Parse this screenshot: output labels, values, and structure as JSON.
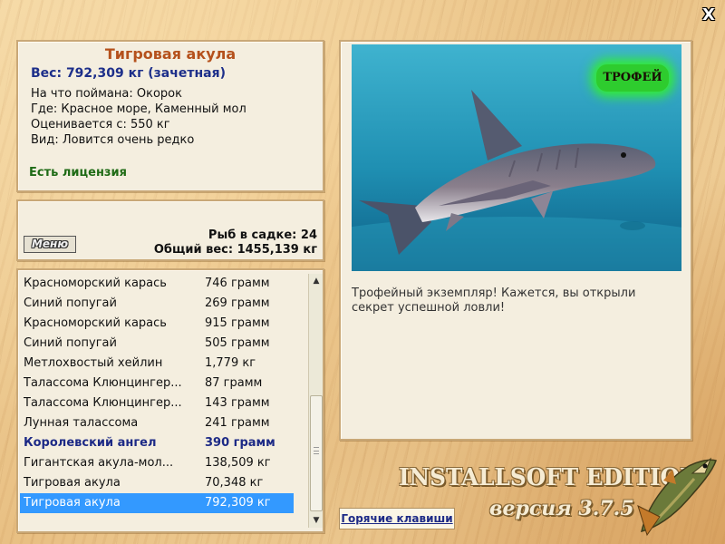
{
  "window": {
    "close_label": "X"
  },
  "fish": {
    "name": "Тигровая акула",
    "weight": "Вес: 792,309 кг (зачетная)",
    "bait": "На что поймана: Окорок",
    "location": "Где: Красное море, Каменный мол",
    "valued_from": "Оценивается с: 550 кг",
    "species": "Вид: Ловится очень редко",
    "license": "Есть лицензия"
  },
  "stats": {
    "menu_label": "Меню",
    "fish_in_keepnet": "Рыб в садке: 24",
    "total_weight": "Общий вес: 1455,139 кг"
  },
  "catch_list": [
    {
      "name": "Красноморский карась",
      "weight": "746 грамм",
      "style": "normal"
    },
    {
      "name": "Синий попугай",
      "weight": "269 грамм",
      "style": "normal"
    },
    {
      "name": "Красноморский карась",
      "weight": "915 грамм",
      "style": "normal"
    },
    {
      "name": "Синий попугай",
      "weight": "505 грамм",
      "style": "normal"
    },
    {
      "name": "Метлохвостый хейлин",
      "weight": "1,779 кг",
      "style": "normal"
    },
    {
      "name": "Талассома Клюнцингер...",
      "weight": "87 грамм",
      "style": "normal"
    },
    {
      "name": "Талассома Клюнцингер...",
      "weight": "143 грамм",
      "style": "normal"
    },
    {
      "name": "Лунная талассома",
      "weight": "241 грамм",
      "style": "normal"
    },
    {
      "name": "Королевский ангел",
      "weight": "390 грамм",
      "style": "bold"
    },
    {
      "name": "Гигантская акула-мол...",
      "weight": "138,509 кг",
      "style": "normal"
    },
    {
      "name": "Тигровая акула",
      "weight": "70,348 кг",
      "style": "normal"
    },
    {
      "name": "Тигровая акула",
      "weight": "792,309 кг",
      "style": "selected"
    }
  ],
  "scrollbar": {
    "up_icon": "▲",
    "down_icon": "▼"
  },
  "photo": {
    "trophy_badge": "ТРОФЕЙ",
    "caption": "Трофейный экземпляр! Кажется, вы открыли секрет успешной ловли!"
  },
  "footer": {
    "hotkeys_label": "Горячие клавиши",
    "brand": "INSTALLSOFT EDITION",
    "version": "версия 3.7.5"
  },
  "colors": {
    "title": "#b5511c",
    "weight": "#1d2f8a",
    "license": "#1f6b16",
    "selection": "#3399ff",
    "water": "#1f8fb2"
  }
}
